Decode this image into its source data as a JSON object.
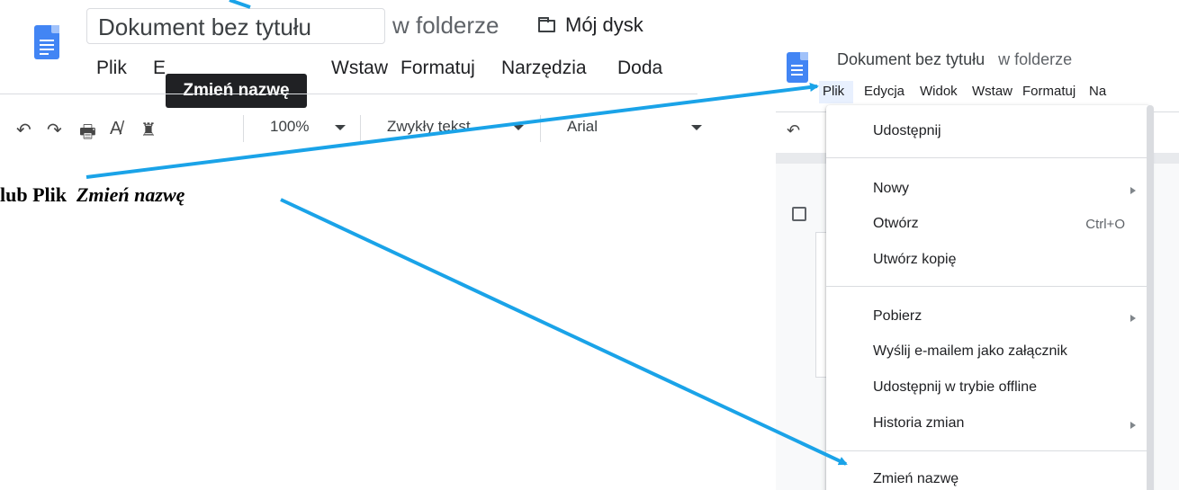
{
  "left": {
    "doc_title": "Dokument bez tytułu",
    "in_folder": "w folderze",
    "drive": "Mój dysk",
    "menu": [
      "Plik",
      "E",
      "Wstaw",
      "Formatuj",
      "Narzędzia",
      "Doda"
    ],
    "tooltip": "Zmień nazwę",
    "zoom": "100%",
    "style": "Zwykły tekst",
    "font": "Arial"
  },
  "right": {
    "doc_title": "Dokument bez tytułu",
    "in_folder": "w folderze",
    "menu": [
      "Plik",
      "Edycja",
      "Widok",
      "Wstaw",
      "Formatuj",
      "Na"
    ],
    "file_menu": {
      "share": "Udostępnij",
      "new": "Nowy",
      "open": "Otwórz",
      "open_shortcut": "Ctrl+O",
      "make_copy": "Utwórz kopię",
      "download": "Pobierz",
      "email": "Wyślij e-mailem jako załącznik",
      "offline": "Udostępnij w trybie offline",
      "history": "Historia zmian",
      "rename": "Zmień nazwę"
    }
  },
  "annotation": {
    "prefix": "lub Plik",
    "emphasis": "Zmień nazwę"
  },
  "colors": {
    "accent_arrow": "#1aa3e8",
    "docs_blue": "#4285f4"
  }
}
